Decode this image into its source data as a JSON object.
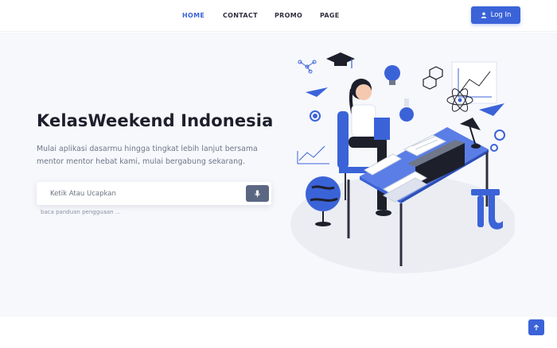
{
  "nav": {
    "items": [
      {
        "label": "HOME"
      },
      {
        "label": "CONTACT"
      },
      {
        "label": "PROMO"
      },
      {
        "label": "PAGE"
      }
    ],
    "active": "HOME",
    "login_label": "Log In",
    "login_icon": "user-icon"
  },
  "hero": {
    "title": "KelasWeekend Indonesia",
    "subtitle": "Mulai aplikasi dasarmu hingga tingkat lebih lanjut bersama mentor mentor hebat kami, mulai bergabung sekarang.",
    "search": {
      "placeholder": "Ketik Atau Ucapkan",
      "value": "",
      "mic_icon": "microphone-icon"
    },
    "help_text": "baca panduan pengguaan ..."
  },
  "back_to_top_icon": "arrow-up-icon",
  "colors": {
    "accent": "#3b63d8",
    "hero_bg": "#f7f8fc",
    "title": "#1d1f2b",
    "subtitle": "#6f7788",
    "mic_bg": "#5b6782"
  }
}
